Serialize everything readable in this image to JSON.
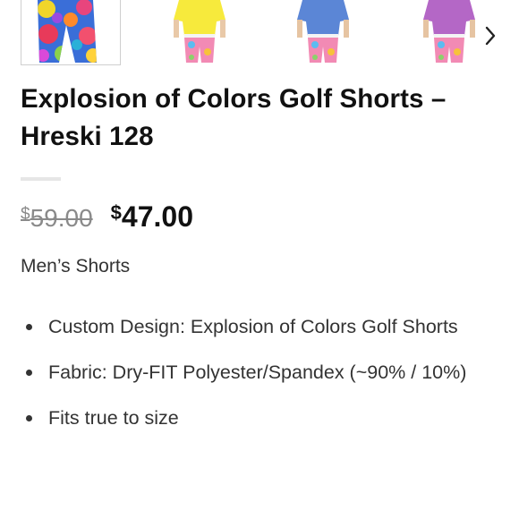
{
  "product": {
    "title": "Explosion of Colors Golf Shorts – Hreski 128",
    "price_original_currency": "$",
    "price_original_amount": "59.00",
    "price_sale_currency": "$",
    "price_sale_amount": "47.00",
    "category": "Men’s Shorts"
  },
  "gallery": {
    "thumbnails": [
      {
        "name": "shorts-flat",
        "shirt_color": ""
      },
      {
        "name": "model-yellow-shirt",
        "shirt_color": "#f7ea3c"
      },
      {
        "name": "model-blue-shirt",
        "shirt_color": "#5b86d6"
      },
      {
        "name": "model-purple-shirt",
        "shirt_color": "#b467c6"
      }
    ],
    "next_icon": "chevron-right-icon"
  },
  "features": [
    "Custom Design: Explosion of Colors Golf Shorts",
    "Fabric: Dry-FIT Polyester/Spandex (~90% / 10%)",
    "Fits true to size"
  ],
  "colors": {
    "title": "#111111",
    "old_price": "#8a8a8a",
    "text": "#333333"
  }
}
